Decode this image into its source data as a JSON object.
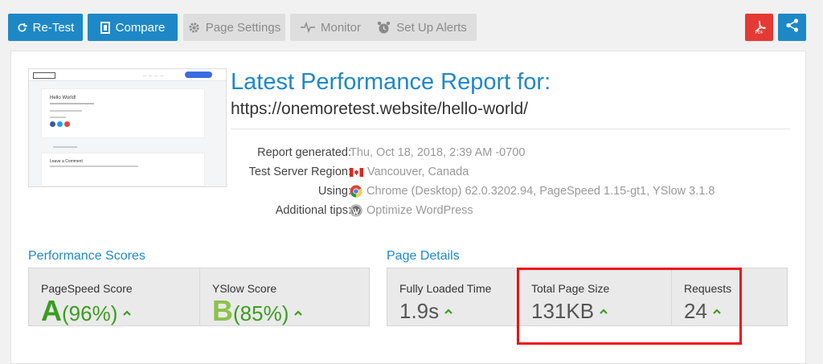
{
  "toolbar": {
    "retest_label": "Re-Test",
    "compare_label": "Compare",
    "page_settings_label": "Page Settings",
    "monitor_label": "Monitor",
    "alerts_label": "Set Up Alerts",
    "pdf_label": "PDF"
  },
  "report": {
    "title": "Latest Performance Report for:",
    "url": "https://onemoretest.website/hello-world/",
    "info": [
      {
        "label": "Report generated:",
        "value": "Thu, Oct 18, 2018, 2:39 AM -0700"
      },
      {
        "label": "Test Server Region:",
        "value": "Vancouver, Canada"
      },
      {
        "label": "Using:",
        "value": "Chrome (Desktop) 62.0.3202.94, PageSpeed 1.15-gt1, YSlow 3.1.8"
      },
      {
        "label": "Additional tips:",
        "value": "Optimize WordPress"
      }
    ]
  },
  "thumbnail": {
    "heading": "Hello World!",
    "comment_heading": "Leave a Comment"
  },
  "performance": {
    "title": "Performance Scores",
    "pagespeed": {
      "label": "PageSpeed Score",
      "grade": "A",
      "percent": "(96%)"
    },
    "yslow": {
      "label": "YSlow Score",
      "grade": "B",
      "percent": "(85%)"
    }
  },
  "details": {
    "title": "Page Details",
    "load_time": {
      "label": "Fully Loaded Time",
      "value": "1.9s"
    },
    "page_size": {
      "label": "Total Page Size",
      "value": "131KB"
    },
    "requests": {
      "label": "Requests",
      "value": "24"
    }
  },
  "colors": {
    "accent": "#1e88c7",
    "grade_a": "#3a9d1f",
    "grade_b": "#8bc34a",
    "highlight": "#e11111",
    "arrow": "#3a9d1f"
  }
}
